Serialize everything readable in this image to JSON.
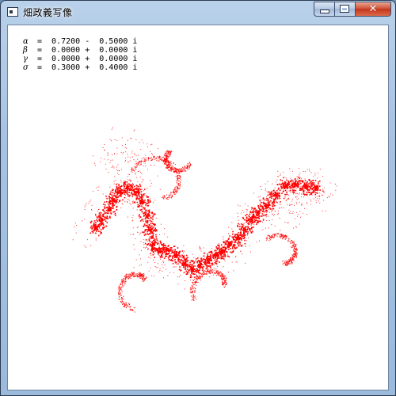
{
  "window": {
    "title": "畑政義写像",
    "controls": {
      "minimize_icon": "minimize-icon",
      "maximize_icon": "maximize-icon",
      "close_icon": "close-icon",
      "close_glyph": "✕"
    }
  },
  "parameters": [
    {
      "symbol": "α",
      "value": "=  0.7200 -  0.5000 i"
    },
    {
      "symbol": "β",
      "value": "=  0.0000 +  0.0000 i"
    },
    {
      "symbol": "γ",
      "value": "=  0.0000 +  0.0000 i"
    },
    {
      "symbol": "σ",
      "value": "=  0.3000 +  0.4000 i"
    }
  ],
  "colors": {
    "fractal": "#ff0000",
    "canvas_background": "#ffffff"
  }
}
